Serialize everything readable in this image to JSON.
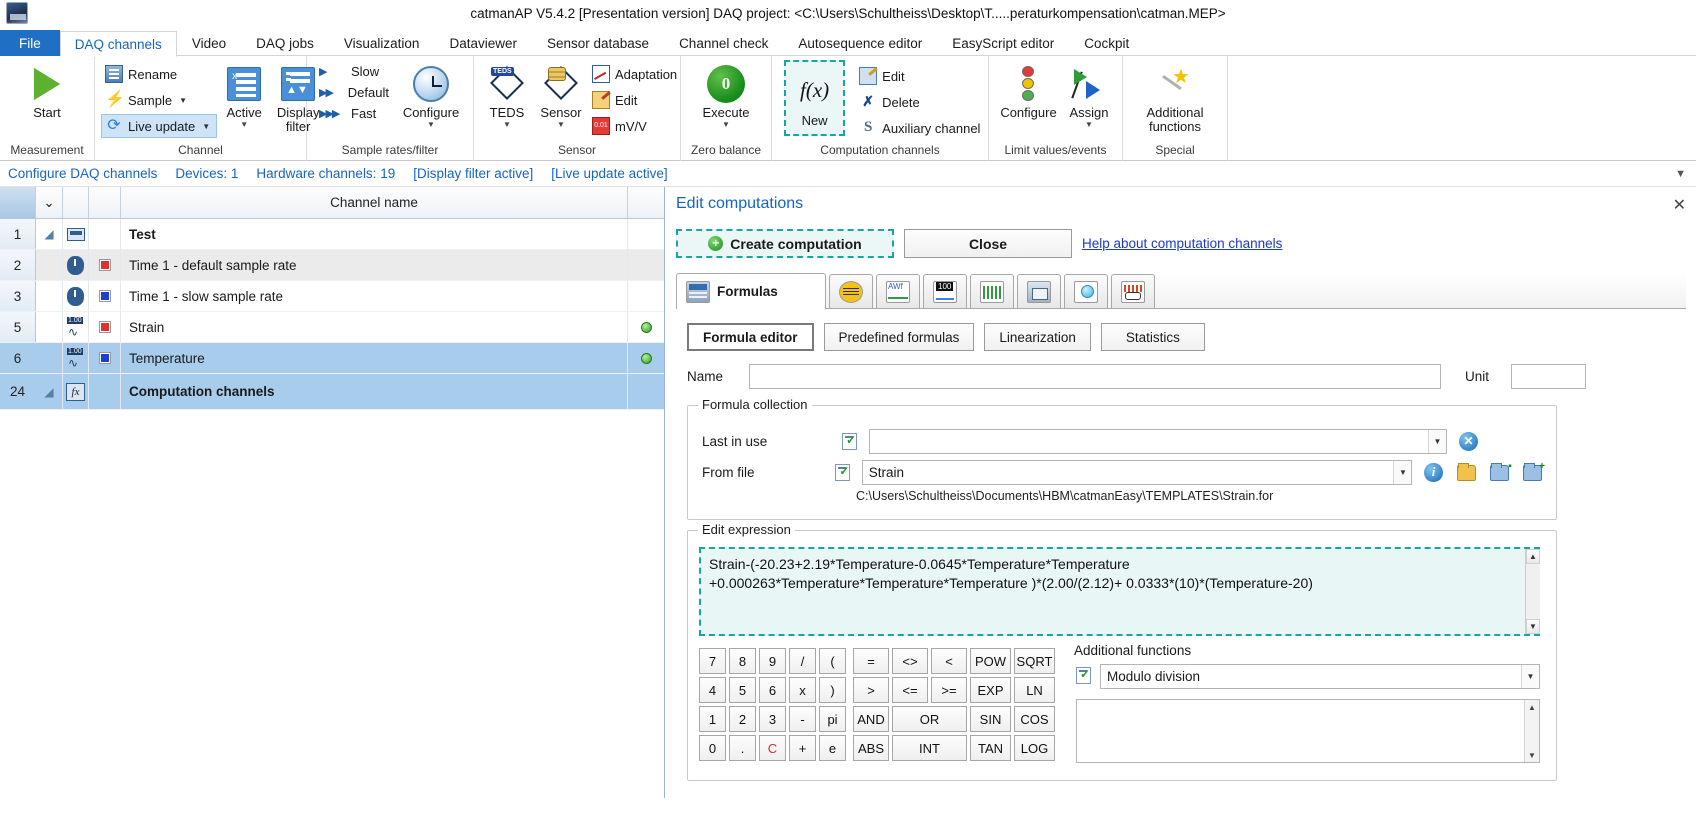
{
  "window": {
    "title": "catmanAP V5.4.2 [Presentation version]  DAQ project: <C:\\Users\\Schultheiss\\Desktop\\T.....peraturkompensation\\catman.MEP>"
  },
  "ribbon": {
    "tabs": [
      {
        "label": "File",
        "kind": "file"
      },
      {
        "label": "DAQ channels",
        "kind": "active"
      },
      {
        "label": "Video",
        "kind": "normal"
      },
      {
        "label": "DAQ jobs",
        "kind": "normal"
      },
      {
        "label": "Visualization",
        "kind": "normal"
      },
      {
        "label": "Dataviewer",
        "kind": "normal"
      },
      {
        "label": "Sensor database",
        "kind": "normal"
      },
      {
        "label": "Channel check",
        "kind": "normal"
      },
      {
        "label": "Autosequence editor",
        "kind": "normal"
      },
      {
        "label": "EasyScript editor",
        "kind": "normal"
      },
      {
        "label": "Cockpit",
        "kind": "normal"
      }
    ],
    "groups": {
      "measurement": {
        "title": "Measurement",
        "start": "Start"
      },
      "channel": {
        "title": "Channel",
        "rename": "Rename",
        "sample": "Sample",
        "live_update": "Live update",
        "active": "Active",
        "display_filter": "Display filter"
      },
      "sample_rates": {
        "title": "Sample rates/filter",
        "slow": "Slow",
        "default": "Default",
        "fast": "Fast",
        "configure": "Configure"
      },
      "sensor": {
        "title": "Sensor",
        "teds": "TEDS",
        "sensor": "Sensor",
        "adaptation": "Adaptation",
        "edit": "Edit",
        "mvv": "mV/V"
      },
      "zero_balance": {
        "title": "Zero balance",
        "execute": "Execute"
      },
      "computation": {
        "title": "Computation channels",
        "fx": "f(x)",
        "new": "New",
        "edit": "Edit",
        "delete": "Delete",
        "auxiliary": "Auxiliary channel"
      },
      "limit_values": {
        "title": "Limit values/events",
        "configure": "Configure",
        "assign": "Assign"
      },
      "special": {
        "title": "Special",
        "additional_functions": "Additional functions"
      }
    }
  },
  "statusbar": {
    "items": [
      "Configure DAQ channels",
      "Devices: 1",
      "Hardware channels: 19",
      "[Display filter active]",
      "[Live update active]"
    ],
    "collapse_icon": "chevron-down-icon"
  },
  "channel_grid": {
    "header": {
      "channel_name": "Channel name",
      "sort_marker": "⌄"
    },
    "rows": [
      {
        "num": "1",
        "icon": "device-icon",
        "color": "",
        "name": "Test",
        "style": "group",
        "led": false
      },
      {
        "num": "2",
        "icon": "clock-icon",
        "color": "#e03131",
        "name": "Time  1 - default sample rate",
        "style": "alt",
        "led": false
      },
      {
        "num": "3",
        "icon": "clock-icon",
        "color": "#1c3fd0",
        "name": "Time  1 - slow sample rate",
        "style": "plain",
        "led": false
      },
      {
        "num": "5",
        "icon": "analog-icon",
        "color": "#e03131",
        "name": "Strain",
        "style": "plain",
        "led": true
      },
      {
        "num": "6",
        "icon": "analog-icon",
        "color": "#1c3fd0",
        "name": "Temperature",
        "style": "sel",
        "led": true
      },
      {
        "num": "24",
        "icon": "fx-icon",
        "color": "",
        "name": "Computation channels",
        "style": "tail",
        "led": false
      }
    ]
  },
  "panel": {
    "title": "Edit computations",
    "close_icon": "close-icon",
    "create_button": "Create computation",
    "close_button": "Close",
    "help_link": "Help about computation channels",
    "icon_tabs": [
      {
        "label": "Formulas",
        "icon": "calculator-icon",
        "active": true
      },
      {
        "label": "",
        "icon": "wires-icon",
        "active": false
      },
      {
        "label": "",
        "icon": "frequency-icon",
        "active": false
      },
      {
        "label": "",
        "icon": "counter-icon",
        "active": false
      },
      {
        "label": "",
        "icon": "histogram-icon",
        "active": false
      },
      {
        "label": "",
        "icon": "box-icon",
        "active": false
      },
      {
        "label": "",
        "icon": "bulb-icon",
        "active": false
      },
      {
        "label": "",
        "icon": "scope-icon",
        "active": false
      }
    ],
    "sub_tabs": [
      {
        "label": "Formula editor",
        "active": true
      },
      {
        "label": "Predefined formulas",
        "active": false
      },
      {
        "label": "Linearization",
        "active": false
      },
      {
        "label": "Statistics",
        "active": false
      }
    ],
    "name_label": "Name",
    "name_value": "",
    "unit_label": "Unit",
    "unit_value": "",
    "formula_collection": {
      "legend": "Formula collection",
      "last_in_use_label": "Last in use",
      "last_in_use_value": "",
      "from_file_label": "From file",
      "from_file_value": "Strain",
      "path": "C:\\Users\\Schultheiss\\Documents\\HBM\\catmanEasy\\TEMPLATES\\Strain.for",
      "clear_icon": "clear-circle-icon",
      "info_icon": "info-circle-icon",
      "open_folder_icon": "open-folder-icon",
      "save_folder_icon": "save-folder-icon",
      "new_folder_icon": "new-folder-icon"
    },
    "edit_expression": {
      "legend": "Edit expression",
      "text": "Strain-(-20.23+2.19*Temperature-0.0645*Temperature*Temperature\n+0.000263*Temperature*Temperature*Temperature )*(2.00/(2.12)+ 0.0333*(10)*(Temperature-20)"
    },
    "keypad": {
      "numeric": [
        "7",
        "8",
        "9",
        "/",
        "(",
        "4",
        "5",
        "6",
        "x",
        ")",
        "1",
        "2",
        "3",
        "-",
        "pi",
        "0",
        ".",
        "C",
        "+",
        "e"
      ],
      "operators": [
        "=",
        "<>",
        "<",
        "POW",
        "SQRT",
        ">",
        "<=",
        ">=",
        "EXP",
        "LN",
        "AND",
        "OR",
        "SIN",
        "COS",
        "ABS",
        "INT",
        "TAN",
        "LOG"
      ]
    },
    "additional_functions": {
      "label": "Additional functions",
      "selected": "Modulo division",
      "description": ""
    }
  }
}
